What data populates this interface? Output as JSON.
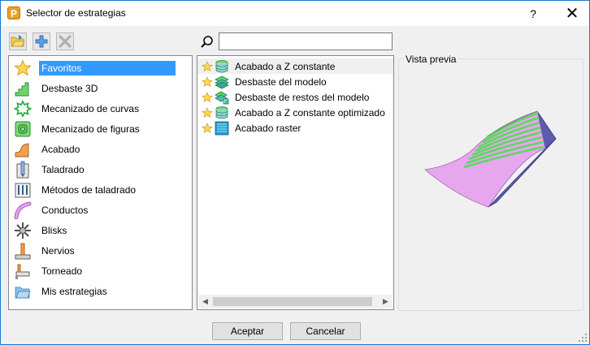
{
  "window": {
    "title": "Selector de estrategias",
    "app_icon_letter": "P",
    "help_label": "?",
    "close_label": "✕"
  },
  "toolbar": {
    "icons": [
      "open-folder-icon",
      "add-icon",
      "delete-icon"
    ]
  },
  "search": {
    "value": "",
    "placeholder": ""
  },
  "categories": [
    {
      "label": "Favoritos",
      "icon": "star-icon",
      "selected": true
    },
    {
      "label": "Desbaste 3D",
      "icon": "roughing-3d-icon"
    },
    {
      "label": "Mecanizado de curvas",
      "icon": "curve-machining-icon"
    },
    {
      "label": "Mecanizado de figuras",
      "icon": "feature-machining-icon"
    },
    {
      "label": "Acabado",
      "icon": "finishing-icon"
    },
    {
      "label": "Taladrado",
      "icon": "drill-icon"
    },
    {
      "label": "Métodos de taladrado",
      "icon": "drill-methods-icon"
    },
    {
      "label": "Conductos",
      "icon": "ports-icon"
    },
    {
      "label": "Blisks",
      "icon": "blisk-icon"
    },
    {
      "label": "Nervios",
      "icon": "ribs-icon"
    },
    {
      "label": "Torneado",
      "icon": "turning-icon"
    },
    {
      "label": "Mis estrategias",
      "icon": "my-strategies-folder-icon"
    }
  ],
  "strategies": [
    {
      "label": "Acabado a Z constante",
      "icon": "constant-z-finishing-icon"
    },
    {
      "label": "Desbaste del modelo",
      "icon": "model-roughing-icon"
    },
    {
      "label": "Desbaste de restos del modelo",
      "icon": "model-rest-roughing-icon"
    },
    {
      "label": "Acabado a Z constante optimizado",
      "icon": "optimized-constant-z-icon"
    },
    {
      "label": "Acabado raster",
      "icon": "raster-finishing-icon"
    }
  ],
  "preview": {
    "title": "Vista previa"
  },
  "buttons": {
    "ok": "Aceptar",
    "cancel": "Cancelar"
  },
  "colors": {
    "selection": "#3399ff",
    "preview_surface_pink": "#e6a7ee",
    "preview_toolpath_green": "#5dd860",
    "preview_side_blue": "#5b5bb0"
  }
}
